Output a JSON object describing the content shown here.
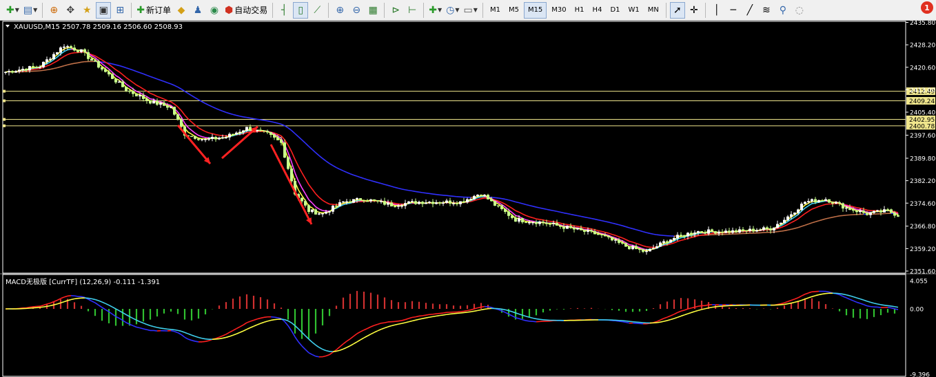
{
  "toolbar": {
    "new_order_label": "新订单",
    "auto_trading_label": "自动交易",
    "timeframes": [
      "M1",
      "M5",
      "M15",
      "M30",
      "H1",
      "H4",
      "D1",
      "W1",
      "MN"
    ],
    "active_timeframe": "M15",
    "alert_count": "1"
  },
  "chart": {
    "symbol_info": "XAUUSD,M15  2507.78 2509.16 2506.60 2508.93",
    "price_ticks": [
      "2435.80",
      "2428.20",
      "2420.60",
      "2413.00",
      "2405.40",
      "2397.60",
      "2389.80",
      "2382.20",
      "2374.60",
      "2366.80",
      "2359.20",
      "2351.60"
    ],
    "horizontal_lines": [
      {
        "label": "2412.49",
        "value": 2412.49
      },
      {
        "label": "2409.24",
        "value": 2409.24
      },
      {
        "label": "2402.95",
        "value": 2402.95
      },
      {
        "label": "2400.78",
        "value": 2400.78
      }
    ],
    "y_range": [
      2351.6,
      2435.8
    ],
    "colors": {
      "bull": "#ffffff",
      "bear": "#c8ff8c",
      "level_line": "#f0e68c",
      "arrow": "#ff2222"
    }
  },
  "macd": {
    "title": "MACD无极版 [CurrTF] (12,26,9) -0.111 -1.391",
    "ticks": [
      "4.055",
      "0.00",
      "-9.396"
    ],
    "y_range": [
      -9.396,
      4.055
    ],
    "colors": {
      "hist_pos": "#d03030",
      "hist_neg": "#30c030",
      "macd_up": "#ff2020",
      "macd_down": "#3030ff",
      "signal_up": "#ffff40",
      "signal_down": "#40d0f0"
    }
  }
}
